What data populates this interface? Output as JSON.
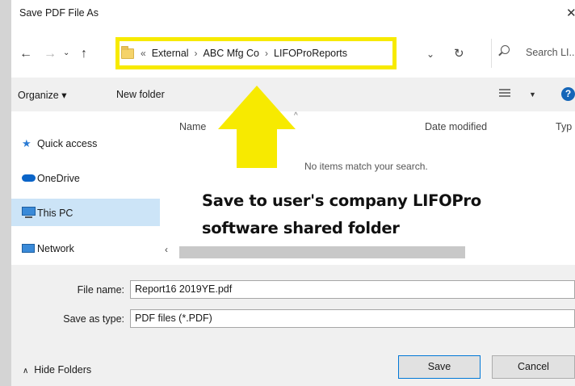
{
  "window": {
    "title": "Save PDF File As"
  },
  "address": {
    "crumbs": [
      "External",
      "ABC Mfg Co",
      "LIFOProReports"
    ],
    "overflow": "«"
  },
  "search": {
    "placeholder": "Search LI..."
  },
  "toolbar": {
    "organize": "Organize",
    "new_folder": "New folder"
  },
  "sidebar": {
    "items": [
      {
        "label": "Quick access",
        "icon": "star-icon"
      },
      {
        "label": "OneDrive",
        "icon": "cloud-icon"
      },
      {
        "label": "This PC",
        "icon": "monitor-icon",
        "selected": true
      },
      {
        "label": "Network",
        "icon": "network-icon"
      }
    ]
  },
  "columns": {
    "name": "Name",
    "date_modified": "Date modified",
    "type": "Typ"
  },
  "content": {
    "empty_message": "No items match your search."
  },
  "annotation": {
    "line1": "Save to user's company LIFOPro",
    "line2": "software shared folder",
    "highlight_color": "#f7ea00"
  },
  "form": {
    "file_name_label": "File name:",
    "file_name_value": "Report16 2019YE.pdf",
    "save_type_label": "Save as type:",
    "save_type_value": "PDF files (*.PDF)"
  },
  "buttons": {
    "save": "Save",
    "cancel": "Cancel",
    "hide_folders": "Hide Folders"
  },
  "colors": {
    "accent": "#0078d7",
    "selected_bg": "#cce4f7",
    "help": "#1566b8"
  }
}
